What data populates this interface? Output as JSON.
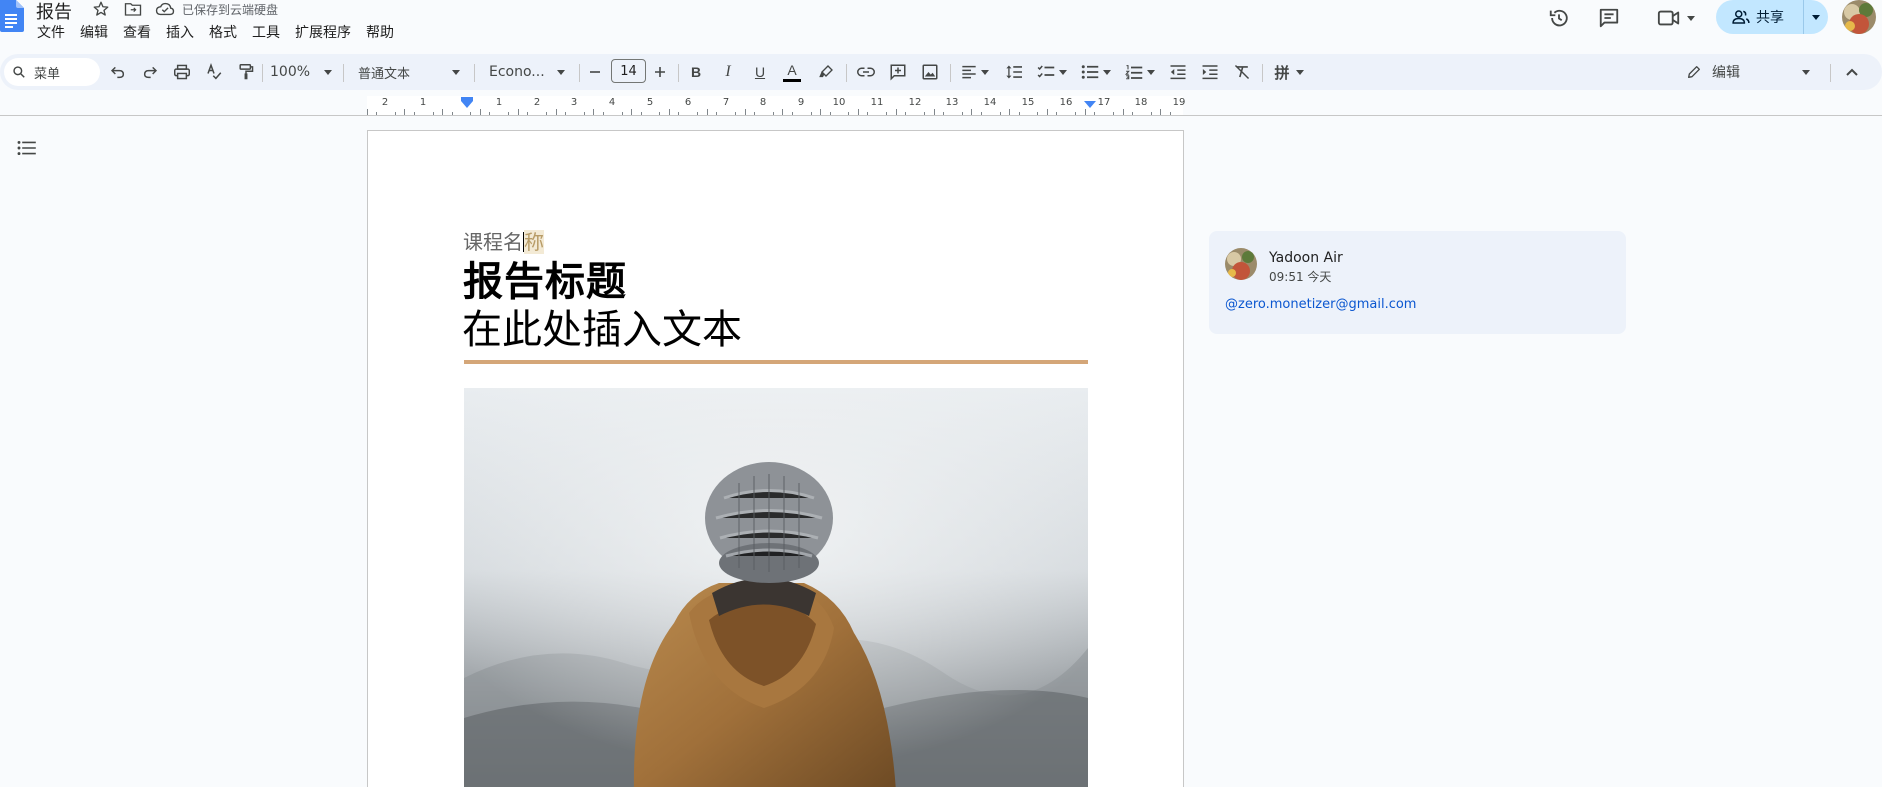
{
  "app": {
    "doc_title": "报告",
    "saved_status": "已保存到云端硬盘",
    "brand_color": "#4285f4"
  },
  "menu": [
    "文件",
    "编辑",
    "查看",
    "插入",
    "格式",
    "工具",
    "扩展程序",
    "帮助"
  ],
  "top_right": {
    "share_label": "共享",
    "share_bg": "#c2e7ff"
  },
  "toolbar": {
    "search_label": "菜单",
    "zoom": "100%",
    "style": "普通文本",
    "font": "Econo...",
    "font_size": "14",
    "bold": "B",
    "italic": "I",
    "underline": "U",
    "text_color": "A",
    "pinyin": "拼",
    "mode": "编辑"
  },
  "ruler": {
    "numbers_left": [
      "2",
      "1"
    ],
    "numbers": [
      "1",
      "2",
      "3",
      "4",
      "5",
      "6",
      "7",
      "8",
      "9",
      "10",
      "11",
      "12",
      "13",
      "14",
      "15",
      "16",
      "17",
      "18",
      "19"
    ]
  },
  "document": {
    "course_name_main": "课程名",
    "course_name_selected": "称",
    "report_title": "报告标题",
    "body_text": "在此处插入文本",
    "rule_color": "#d4a678"
  },
  "comment": {
    "author": "Yadoon Air",
    "time": "09:51 今天",
    "body": "@zero.monetizer@gmail.com"
  }
}
